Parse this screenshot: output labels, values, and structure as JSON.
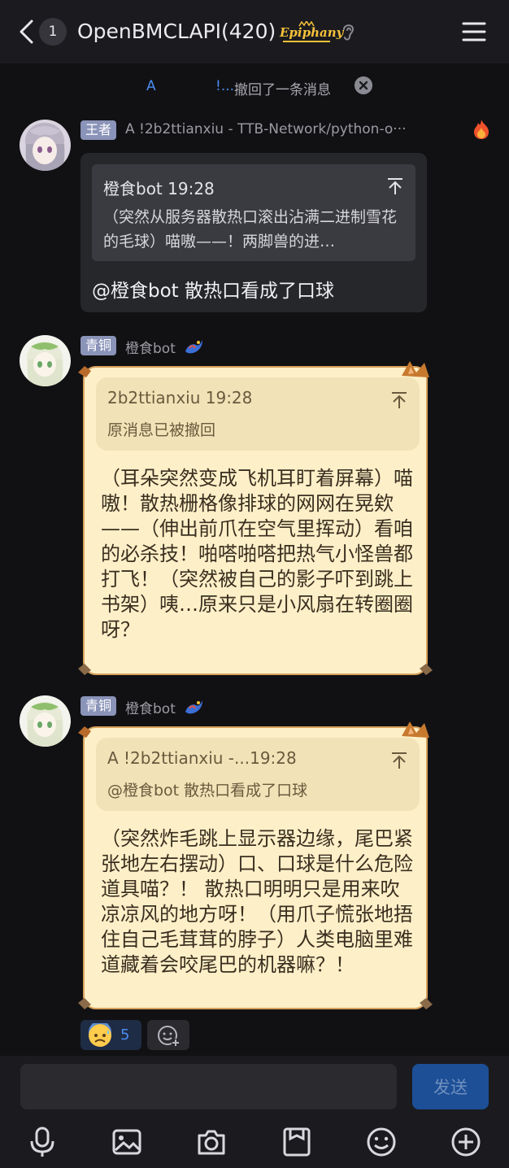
{
  "header": {
    "unread_count": "1",
    "title": "OpenBMCLAPI(420)",
    "title_badge": "Epiphany"
  },
  "recall_notice": {
    "user": "A",
    "name_fragment": "!...",
    "text": "撤回了一条消息"
  },
  "messages": [
    {
      "tag": "王者",
      "sender": "A              !2b2ttianxiu - TTB-Network/python-o···",
      "quote": {
        "author_time": "橙食bot 19:28",
        "text": "（突然从服务器散热口滚出沾满二进制雪花的毛球）喵嗷——！两脚兽的进…"
      },
      "text": "@橙食bot 散热口看成了口球"
    },
    {
      "tag": "青铜",
      "sender": "橙食bot",
      "quote": {
        "author_time": "2b2ttianxiu 19:28",
        "text": "原消息已被撤回"
      },
      "text": "（耳朵突然变成飞机耳盯着屏幕）喵嗷！散热栅格像排球的网网在晃欸——（伸出前爪在空气里挥动）看咱的必杀技！啪嗒啪嗒把热气小怪兽都打飞！（突然被自己的影子吓到跳上书架）咦…原来只是小风扇在转圈圈呀？"
    },
    {
      "tag": "青铜",
      "sender": "橙食bot",
      "quote": {
        "author_time": "A              !2b2ttianxiu -...19:28",
        "text": "@橙食bot 散热口看成了口球"
      },
      "text": "（突然炸毛跳上显示器边缘，尾巴紧张地左右摆动）口、口球是什么危险道具喵？！ 散热口明明只是用来吹凉凉风的地方呀！（用爪子慌张地捂住自己毛茸茸的脖子）人类电脑里难道藏着会咬尾巴的机器嘛？！"
    }
  ],
  "reaction": {
    "emoji_icon": "anxious-face-with-sweat",
    "count": "5"
  },
  "composer": {
    "placeholder": "",
    "send_label": "发送"
  },
  "toolbar": [
    "microphone-icon",
    "image-icon",
    "camera-icon",
    "archive-icon",
    "emoji-icon",
    "plus-icon"
  ],
  "colors": {
    "background": "#111114",
    "header": "#1b1b1f",
    "accent_blue": "#4a8cf0",
    "tag_bg": "#8a93b8",
    "cream_bubble": "#fdf0c8",
    "cream_border": "#d8a15c",
    "send_button": "#1c4f96"
  }
}
